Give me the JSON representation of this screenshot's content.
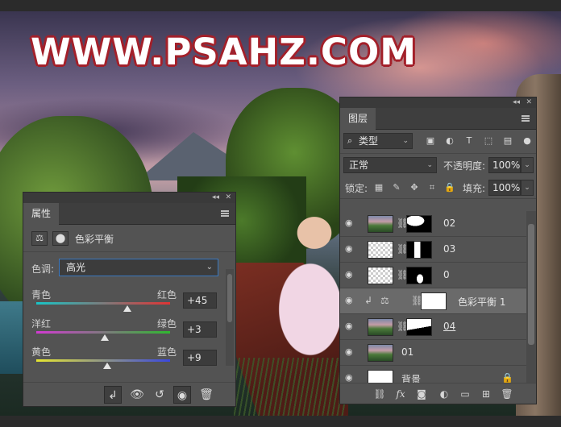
{
  "watermark": "WWW.PSAHZ.COM",
  "properties": {
    "tab": "属性",
    "title": "色彩平衡",
    "tone_label": "色调:",
    "tone_value": "高光",
    "sliders": [
      {
        "left": "青色",
        "right": "红色",
        "value": "+45",
        "level": 0.68,
        "gradient": [
          "#18c4c6",
          "#e03434"
        ]
      },
      {
        "left": "洋红",
        "right": "绿色",
        "value": "+3",
        "level": 0.51,
        "gradient": [
          "#d23ad2",
          "#2fb82f"
        ]
      },
      {
        "left": "黄色",
        "right": "蓝色",
        "value": "+9",
        "level": 0.53,
        "gradient": [
          "#e6e630",
          "#3a48e0"
        ]
      }
    ]
  },
  "layers": {
    "tab": "图层",
    "kind": "类型",
    "blend_mode": "正常",
    "opacity_label": "不透明度:",
    "opacity_value": "100%",
    "lock_label": "锁定:",
    "fill_label": "填充:",
    "fill_value": "100%",
    "items": [
      {
        "name": "02",
        "thumb": "photo",
        "mask": "02"
      },
      {
        "name": "03",
        "thumb": "checker",
        "mask": "03"
      },
      {
        "name": "0",
        "thumb": "checker",
        "mask": "0"
      },
      {
        "name": "色彩平衡 1",
        "thumb": "adjust",
        "mask": "white",
        "selected": true
      },
      {
        "name": "04",
        "thumb": "photo",
        "mask": "04"
      },
      {
        "name": "01",
        "thumb": "photo",
        "mask": null
      },
      {
        "name": "背景",
        "thumb": "white",
        "mask": null,
        "locked": true
      }
    ]
  },
  "colors": {
    "accent": "#3a78c0",
    "panel": "#535353",
    "watermark_outline": "#a3202a"
  }
}
